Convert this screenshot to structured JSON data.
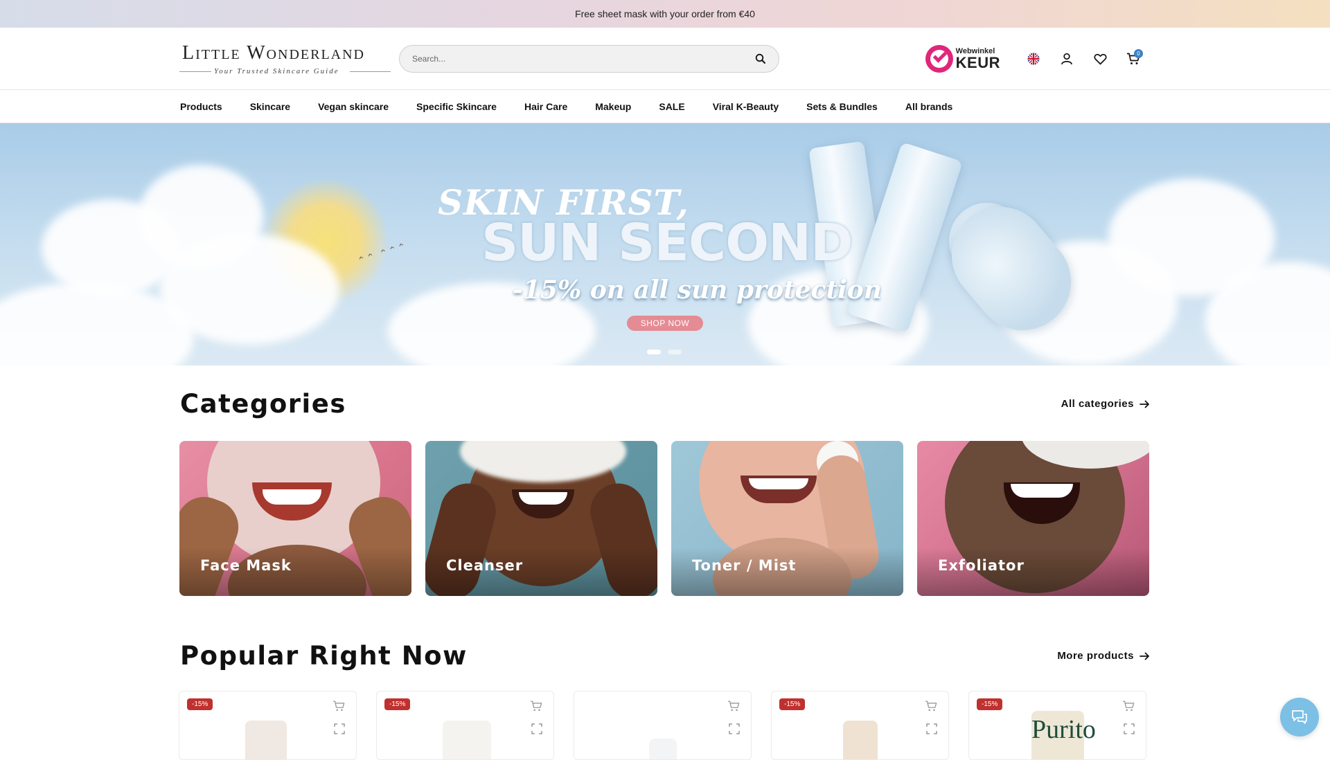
{
  "promo_bar": {
    "text": "Free sheet mask with your order from €40"
  },
  "header": {
    "logo_text": "Little Wonderland",
    "logo_tagline": "Your Trusted Skincare Guide",
    "search_placeholder": "Search...",
    "keur_small": "Webwinkel",
    "keur_big": "KEUR",
    "cart_count": "0",
    "icons": [
      "uk-flag-icon",
      "user-icon",
      "heart-icon",
      "cart-icon"
    ]
  },
  "nav": {
    "items": [
      "Products",
      "Skincare",
      "Vegan skincare",
      "Specific Skincare",
      "Hair Care",
      "Makeup",
      "SALE",
      "Viral K-Beauty",
      "Sets & Bundles",
      "All brands"
    ]
  },
  "hero": {
    "line1": "SKIN FIRST,",
    "line2": "SUN SECOND",
    "line3": "-15% on all sun protection",
    "button": "SHOP NOW",
    "slides": 2,
    "active_slide": 1,
    "button_color": "#e58b93"
  },
  "categories": {
    "title": "Categories",
    "link": "All categories",
    "items": [
      {
        "label": "Face Mask"
      },
      {
        "label": "Cleanser"
      },
      {
        "label": "Toner / Mist"
      },
      {
        "label": "Exfoliator"
      }
    ]
  },
  "popular": {
    "title": "Popular Right Now",
    "link": "More products",
    "products": [
      {
        "badge": "-15%"
      },
      {
        "badge": "-15%"
      },
      {
        "badge": ""
      },
      {
        "badge": "-15%"
      },
      {
        "badge": "-15%",
        "brand_text": "Purito"
      }
    ],
    "badge_color": "#c0302e"
  },
  "chat": {
    "icon": "chat-icon",
    "color": "#7cc0e6"
  }
}
